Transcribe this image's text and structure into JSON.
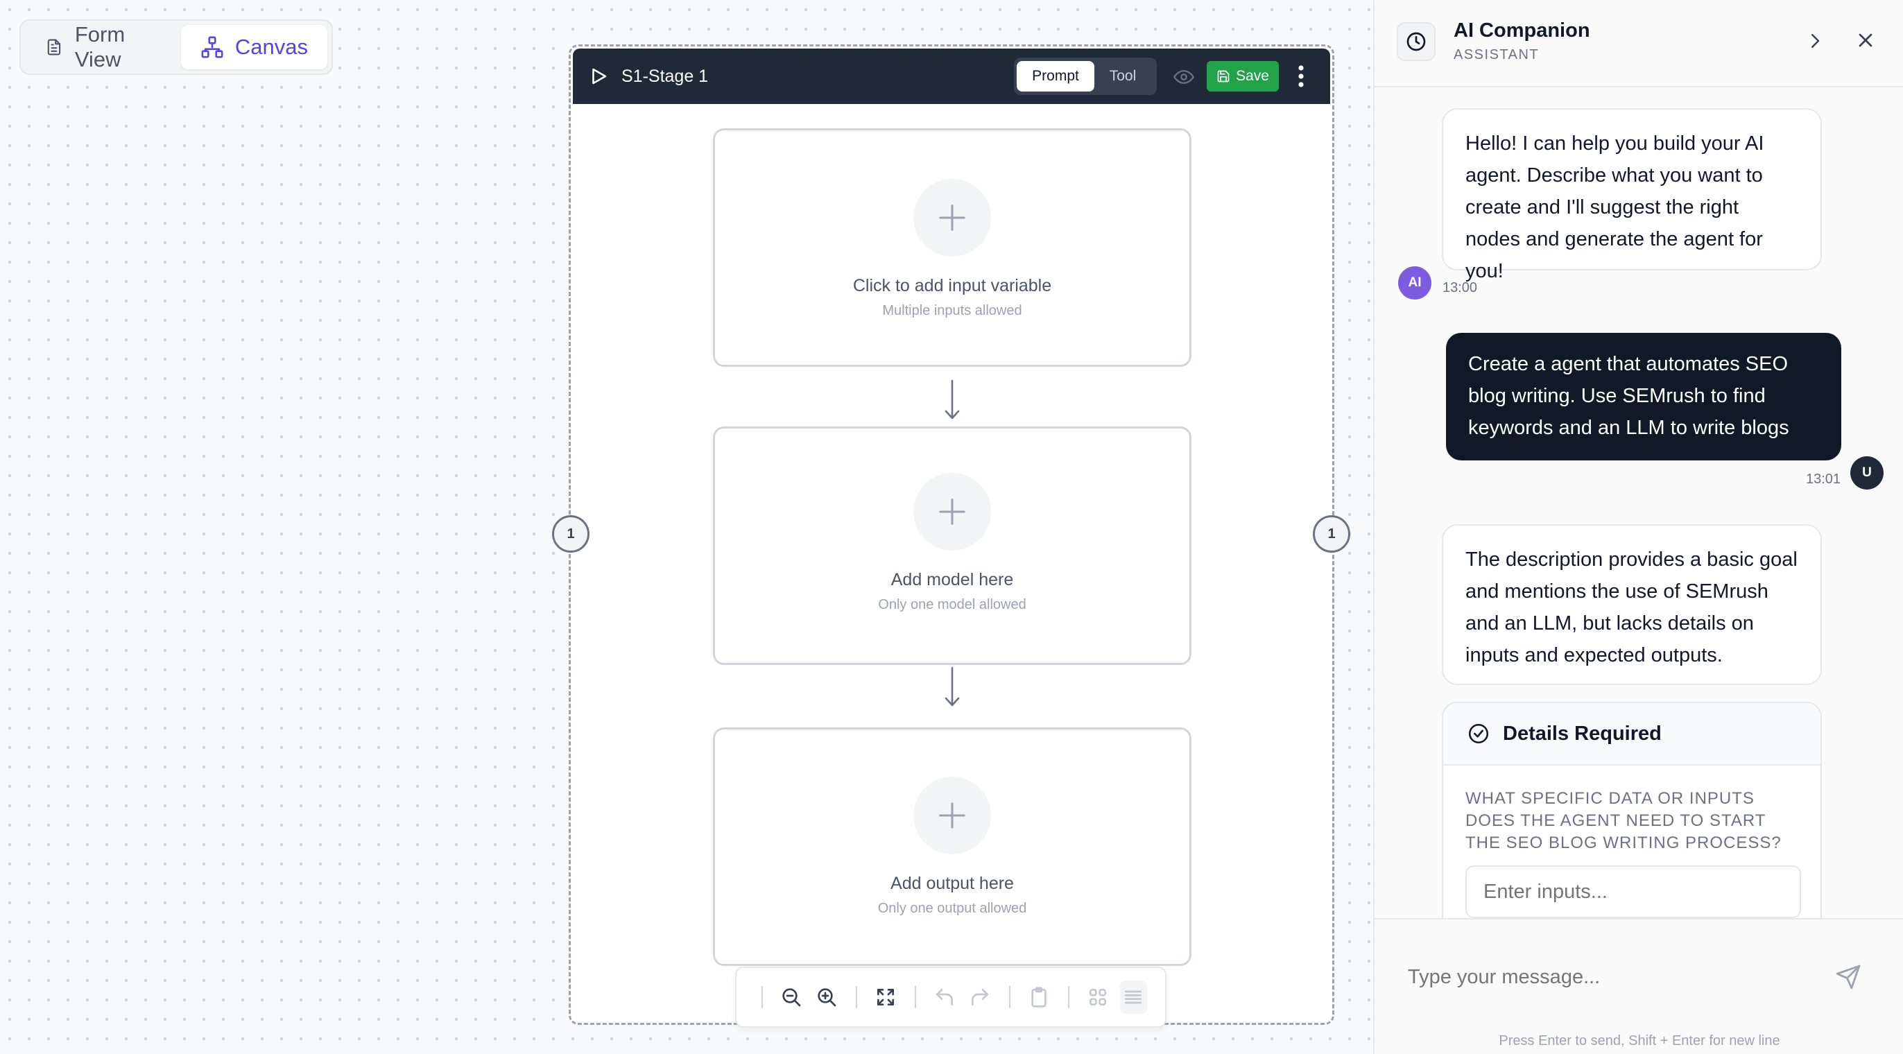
{
  "view_toggle": {
    "form_view_label": "Form View",
    "canvas_label": "Canvas",
    "active": "Canvas"
  },
  "stage": {
    "title": "S1-Stage 1",
    "tabs": [
      {
        "label": "Prompt",
        "active": true
      },
      {
        "label": "Tool",
        "active": false
      }
    ],
    "save_label": "Save",
    "left_port_label": "1",
    "right_port_label": "1",
    "nodes": [
      {
        "title": "Click to add input variable",
        "subtitle": "Multiple inputs allowed"
      },
      {
        "title": "Add model here",
        "subtitle": "Only one model allowed"
      },
      {
        "title": "Add output here",
        "subtitle": "Only one output allowed"
      }
    ]
  },
  "toolbar": {
    "icons": [
      "zoom-out-icon",
      "zoom-in-icon",
      "fit-view-icon",
      "undo-icon",
      "redo-icon",
      "clipboard-icon",
      "grid-icon",
      "list-icon"
    ]
  },
  "panel": {
    "title": "AI Companion",
    "subtitle": "ASSISTANT",
    "messages": [
      {
        "role": "ai",
        "avatar": "AI",
        "text": "Hello! I can help you build your AI agent. Describe what you want to create and I'll suggest the right nodes and generate the agent for you!",
        "time": "13:00"
      },
      {
        "role": "user",
        "avatar": "U",
        "text": "Create a agent that automates SEO blog writing. Use SEMrush to find keywords and an LLM to write blogs",
        "time": "13:01"
      },
      {
        "role": "ai",
        "text": "The description provides a basic goal and mentions the use of SEMrush and an LLM, but lacks details on inputs and expected outputs."
      }
    ],
    "details": {
      "title": "Details Required",
      "question": "WHAT SPECIFIC DATA OR INPUTS DOES THE AGENT NEED TO START THE SEO BLOG WRITING PROCESS?",
      "input_placeholder": "Enter inputs..."
    },
    "composer": {
      "placeholder": "Type your message...",
      "hint": "Press Enter to send, Shift + Enter for new line"
    }
  },
  "colors": {
    "accent": "#4f46e5",
    "header_dark": "#1f2937",
    "save_green": "#22a34a",
    "user_bubble": "#111827",
    "ai_avatar": "#7c5ce0"
  }
}
